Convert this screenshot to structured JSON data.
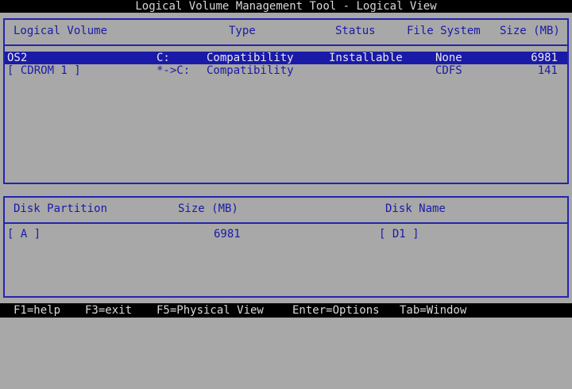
{
  "title": "Logical Volume Management Tool - Logical View",
  "volume_panel": {
    "headers": {
      "logical_volume": "Logical Volume",
      "type": "Type",
      "status": "Status",
      "file_system": "File System",
      "size": "Size (MB)"
    },
    "rows": [
      {
        "name": "OS2",
        "drive": "C:",
        "type": "Compatibility",
        "status": "Installable",
        "file_system": "None",
        "size": "6981",
        "selected": true
      },
      {
        "name": "[ CDROM 1 ]",
        "drive": "*->C:",
        "type": "Compatibility",
        "status": "",
        "file_system": "CDFS",
        "size": "141",
        "selected": false
      }
    ]
  },
  "partition_panel": {
    "headers": {
      "disk_partition": "Disk Partition",
      "size": "Size (MB)",
      "disk_name": "Disk Name"
    },
    "rows": [
      {
        "partition": "[ A ]",
        "size": "6981",
        "disk_name": "[ D1 ]"
      }
    ]
  },
  "statusbar": {
    "help": "F1=help",
    "exit": "F3=exit",
    "physical_view": "F5=Physical View",
    "options": "Enter=Options",
    "window": "Tab=Window"
  }
}
